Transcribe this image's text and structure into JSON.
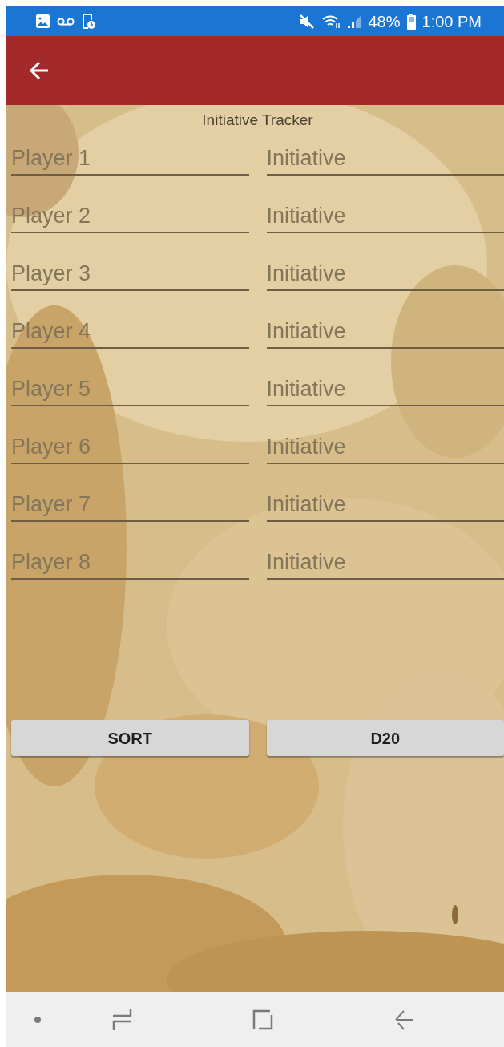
{
  "status_bar": {
    "battery": "48%",
    "time": "1:00 PM"
  },
  "title": "Initiative Tracker",
  "rows": [
    {
      "player_placeholder": "Player 1",
      "initiative_placeholder": "Initiative"
    },
    {
      "player_placeholder": "Player 2",
      "initiative_placeholder": "Initiative"
    },
    {
      "player_placeholder": "Player 3",
      "initiative_placeholder": "Initiative"
    },
    {
      "player_placeholder": "Player 4",
      "initiative_placeholder": "Initiative"
    },
    {
      "player_placeholder": "Player 5",
      "initiative_placeholder": "Initiative"
    },
    {
      "player_placeholder": "Player 6",
      "initiative_placeholder": "Initiative"
    },
    {
      "player_placeholder": "Player 7",
      "initiative_placeholder": "Initiative"
    },
    {
      "player_placeholder": "Player 8",
      "initiative_placeholder": "Initiative"
    }
  ],
  "buttons": [
    "SORT",
    "D20"
  ]
}
